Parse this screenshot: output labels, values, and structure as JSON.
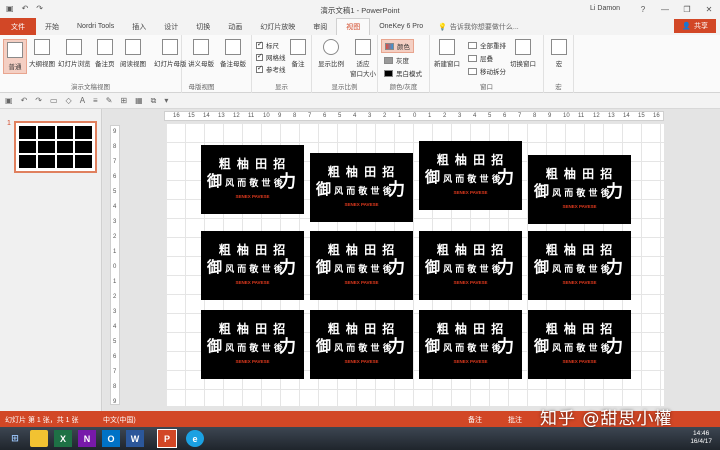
{
  "window": {
    "title": "演示文稿1 - PowerPoint",
    "user": "Li Damon",
    "minimize": "—",
    "restore": "❐",
    "close": "✕",
    "help": "?"
  },
  "tabs": [
    "文件",
    "开始",
    "Nordri Tools",
    "插入",
    "设计",
    "切换",
    "动画",
    "幻灯片放映",
    "审阅",
    "视图",
    "OneKey 6 Pro"
  ],
  "active_tab": "视图",
  "tell_me": "告诉我你想要做什么...",
  "share": "共享",
  "ribbon": {
    "views": {
      "normal": "普通",
      "outline": "大纲视图",
      "sorter": "幻灯片浏览",
      "notes": "备注页",
      "reading": "阅读视图",
      "label": "演示文稿视图"
    },
    "masters": {
      "slide_master": "幻灯片母版",
      "handout_master": "讲义母版",
      "notes_master": "备注母版",
      "label": "母版视图"
    },
    "show": {
      "ruler": "标尺",
      "gridlines": "网格线",
      "guides": "参考线",
      "notes": "备注",
      "label": "显示"
    },
    "zoom": {
      "zoom": "显示比例",
      "fit": "适应\n窗口大小",
      "label": "显示比例"
    },
    "color": {
      "color": "颜色",
      "grayscale": "灰度",
      "bw": "黑白模式",
      "label": "颜色/灰度"
    },
    "window": {
      "new_window": "新建窗口",
      "arrange_all": "全部重排",
      "cascade": "层叠",
      "move_split": "移动拆分",
      "switch": "切换窗口",
      "label": "窗口"
    },
    "macros": {
      "macro": "宏",
      "label": "宏"
    }
  },
  "card": {
    "line1": "粗 柚 田 招",
    "line2a": "御",
    "line2b": "风 而 敬 世 後",
    "line2c": "力",
    "sub": "SENEX PAVESE"
  },
  "hruler": [
    "16",
    "15",
    "14",
    "13",
    "12",
    "11",
    "10",
    "9",
    "8",
    "7",
    "6",
    "5",
    "4",
    "3",
    "2",
    "1",
    "0",
    "1",
    "2",
    "3",
    "4",
    "5",
    "6",
    "7",
    "8",
    "9",
    "10",
    "11",
    "12",
    "13",
    "14",
    "15",
    "16"
  ],
  "vruler": [
    "9",
    "8",
    "7",
    "6",
    "5",
    "4",
    "3",
    "2",
    "1",
    "0",
    "1",
    "2",
    "3",
    "4",
    "5",
    "6",
    "7",
    "8",
    "9"
  ],
  "thumb_num": "1",
  "status": {
    "slide_info": "幻灯片 第 1 张，共 1 张",
    "language": "中文(中国)",
    "notes": "备注",
    "comments": "批注"
  },
  "taskbar": {
    "time": "14:46",
    "date": "16/4/17"
  },
  "watermark": "知乎 @甜思小權"
}
